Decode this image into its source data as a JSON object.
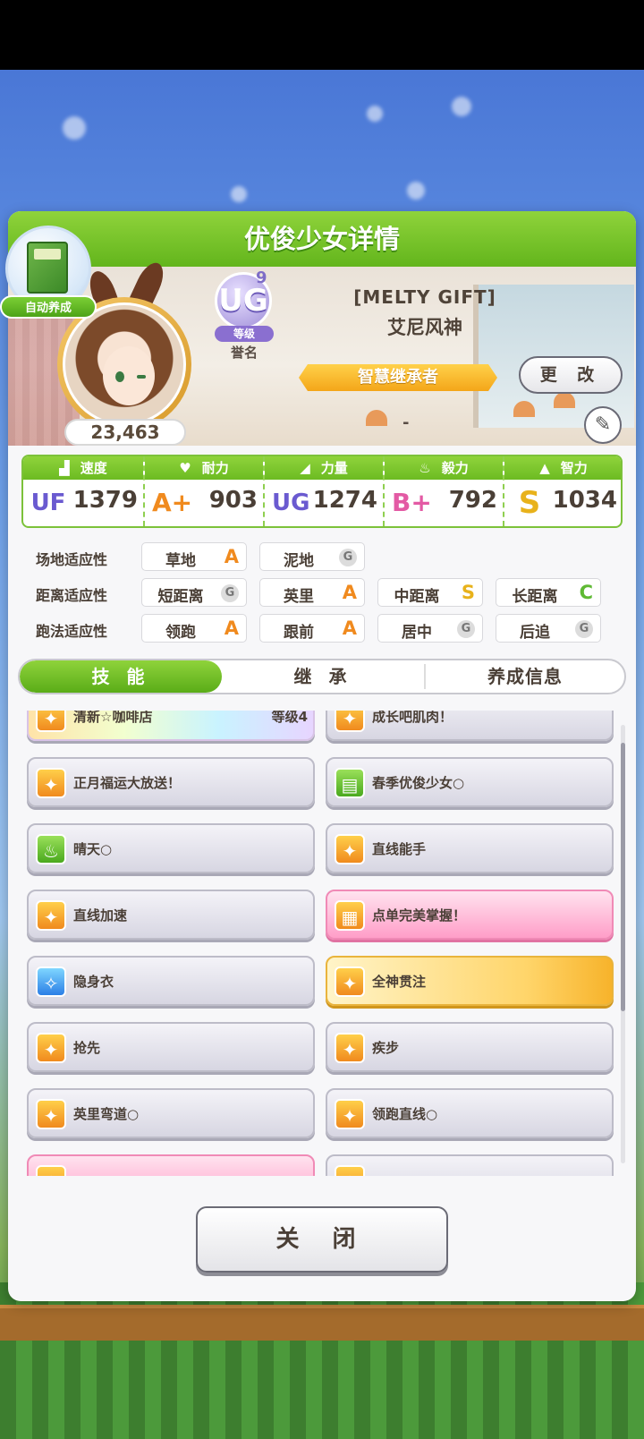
{
  "header": {
    "title": "优俊少女详情"
  },
  "badge": {
    "label": "自动养成"
  },
  "profile": {
    "fans": "23,463",
    "rank_letters": "UG",
    "rank_num": "9",
    "rank_tag": "等级",
    "rank_title": "誉名",
    "costume": "[MELTY GIFT]",
    "name": "艾尼风神",
    "subtitle": "智慧继承者",
    "change_label": "更 改",
    "edit_icon": "pencil-icon",
    "dash": "-"
  },
  "stats": [
    {
      "label": "速度",
      "icon": "shoe-icon",
      "grade": "UF",
      "value": "1379",
      "color": "#6a5ad0"
    },
    {
      "label": "耐力",
      "icon": "heart-icon",
      "grade": "A+",
      "value": "903",
      "color": "#f08a1e"
    },
    {
      "label": "力量",
      "icon": "muscle-icon",
      "grade": "UG",
      "value": "1274",
      "color": "#6a5ad0"
    },
    {
      "label": "毅力",
      "icon": "flame-icon",
      "grade": "B+",
      "value": "792",
      "color": "#e35aa4"
    },
    {
      "label": "智力",
      "icon": "graduation-cap-icon",
      "grade": "S",
      "value": "1034",
      "color": "#e8b21b"
    }
  ],
  "aptitude": {
    "track": {
      "label": "场地适应性",
      "cells": [
        {
          "name": "草地",
          "grade": "A"
        },
        {
          "name": "泥地",
          "grade": "G"
        }
      ]
    },
    "distance": {
      "label": "距离适应性",
      "cells": [
        {
          "name": "短距离",
          "grade": "G"
        },
        {
          "name": "英里",
          "grade": "A"
        },
        {
          "name": "中距离",
          "grade": "S"
        },
        {
          "name": "长距离",
          "grade": "C"
        }
      ]
    },
    "style": {
      "label": "跑法适应性",
      "cells": [
        {
          "name": "领跑",
          "grade": "A"
        },
        {
          "name": "跟前",
          "grade": "A"
        },
        {
          "name": "居中",
          "grade": "G"
        },
        {
          "name": "后追",
          "grade": "G"
        }
      ]
    }
  },
  "tabs": [
    "技 能",
    "继 承",
    "养成信息"
  ],
  "skills": [
    {
      "name": "清新☆咖啡店",
      "level": "等级4",
      "style": "rainbow",
      "icon": "orange"
    },
    {
      "name": "成长吧肌肉！",
      "level": "",
      "style": "normal",
      "icon": "orange"
    },
    {
      "name": "正月福运大放送！",
      "level": "",
      "style": "normal",
      "icon": "orange"
    },
    {
      "name": "春季优俊少女○",
      "level": "",
      "style": "normal",
      "icon": "green"
    },
    {
      "name": "晴天○",
      "level": "",
      "style": "normal",
      "icon": "green"
    },
    {
      "name": "直线能手",
      "level": "",
      "style": "normal",
      "icon": "orange"
    },
    {
      "name": "直线加速",
      "level": "",
      "style": "normal",
      "icon": "orange"
    },
    {
      "name": "点单完美掌握！",
      "level": "",
      "style": "pink",
      "icon": "orange"
    },
    {
      "name": "隐身衣",
      "level": "",
      "style": "normal",
      "icon": "blue"
    },
    {
      "name": "全神贯注",
      "level": "",
      "style": "gold",
      "icon": "orange"
    },
    {
      "name": "抢先",
      "level": "",
      "style": "normal",
      "icon": "orange"
    },
    {
      "name": "疾步",
      "level": "",
      "style": "normal",
      "icon": "orange"
    },
    {
      "name": "英里弯道○",
      "level": "",
      "style": "normal",
      "icon": "orange"
    },
    {
      "name": "领跑直线○",
      "level": "",
      "style": "normal",
      "icon": "orange"
    },
    {
      "name": "",
      "level": "",
      "style": "pink",
      "icon": "orange"
    },
    {
      "name": "",
      "level": "",
      "style": "normal",
      "icon": "orange"
    }
  ],
  "close_label": "关 闭"
}
